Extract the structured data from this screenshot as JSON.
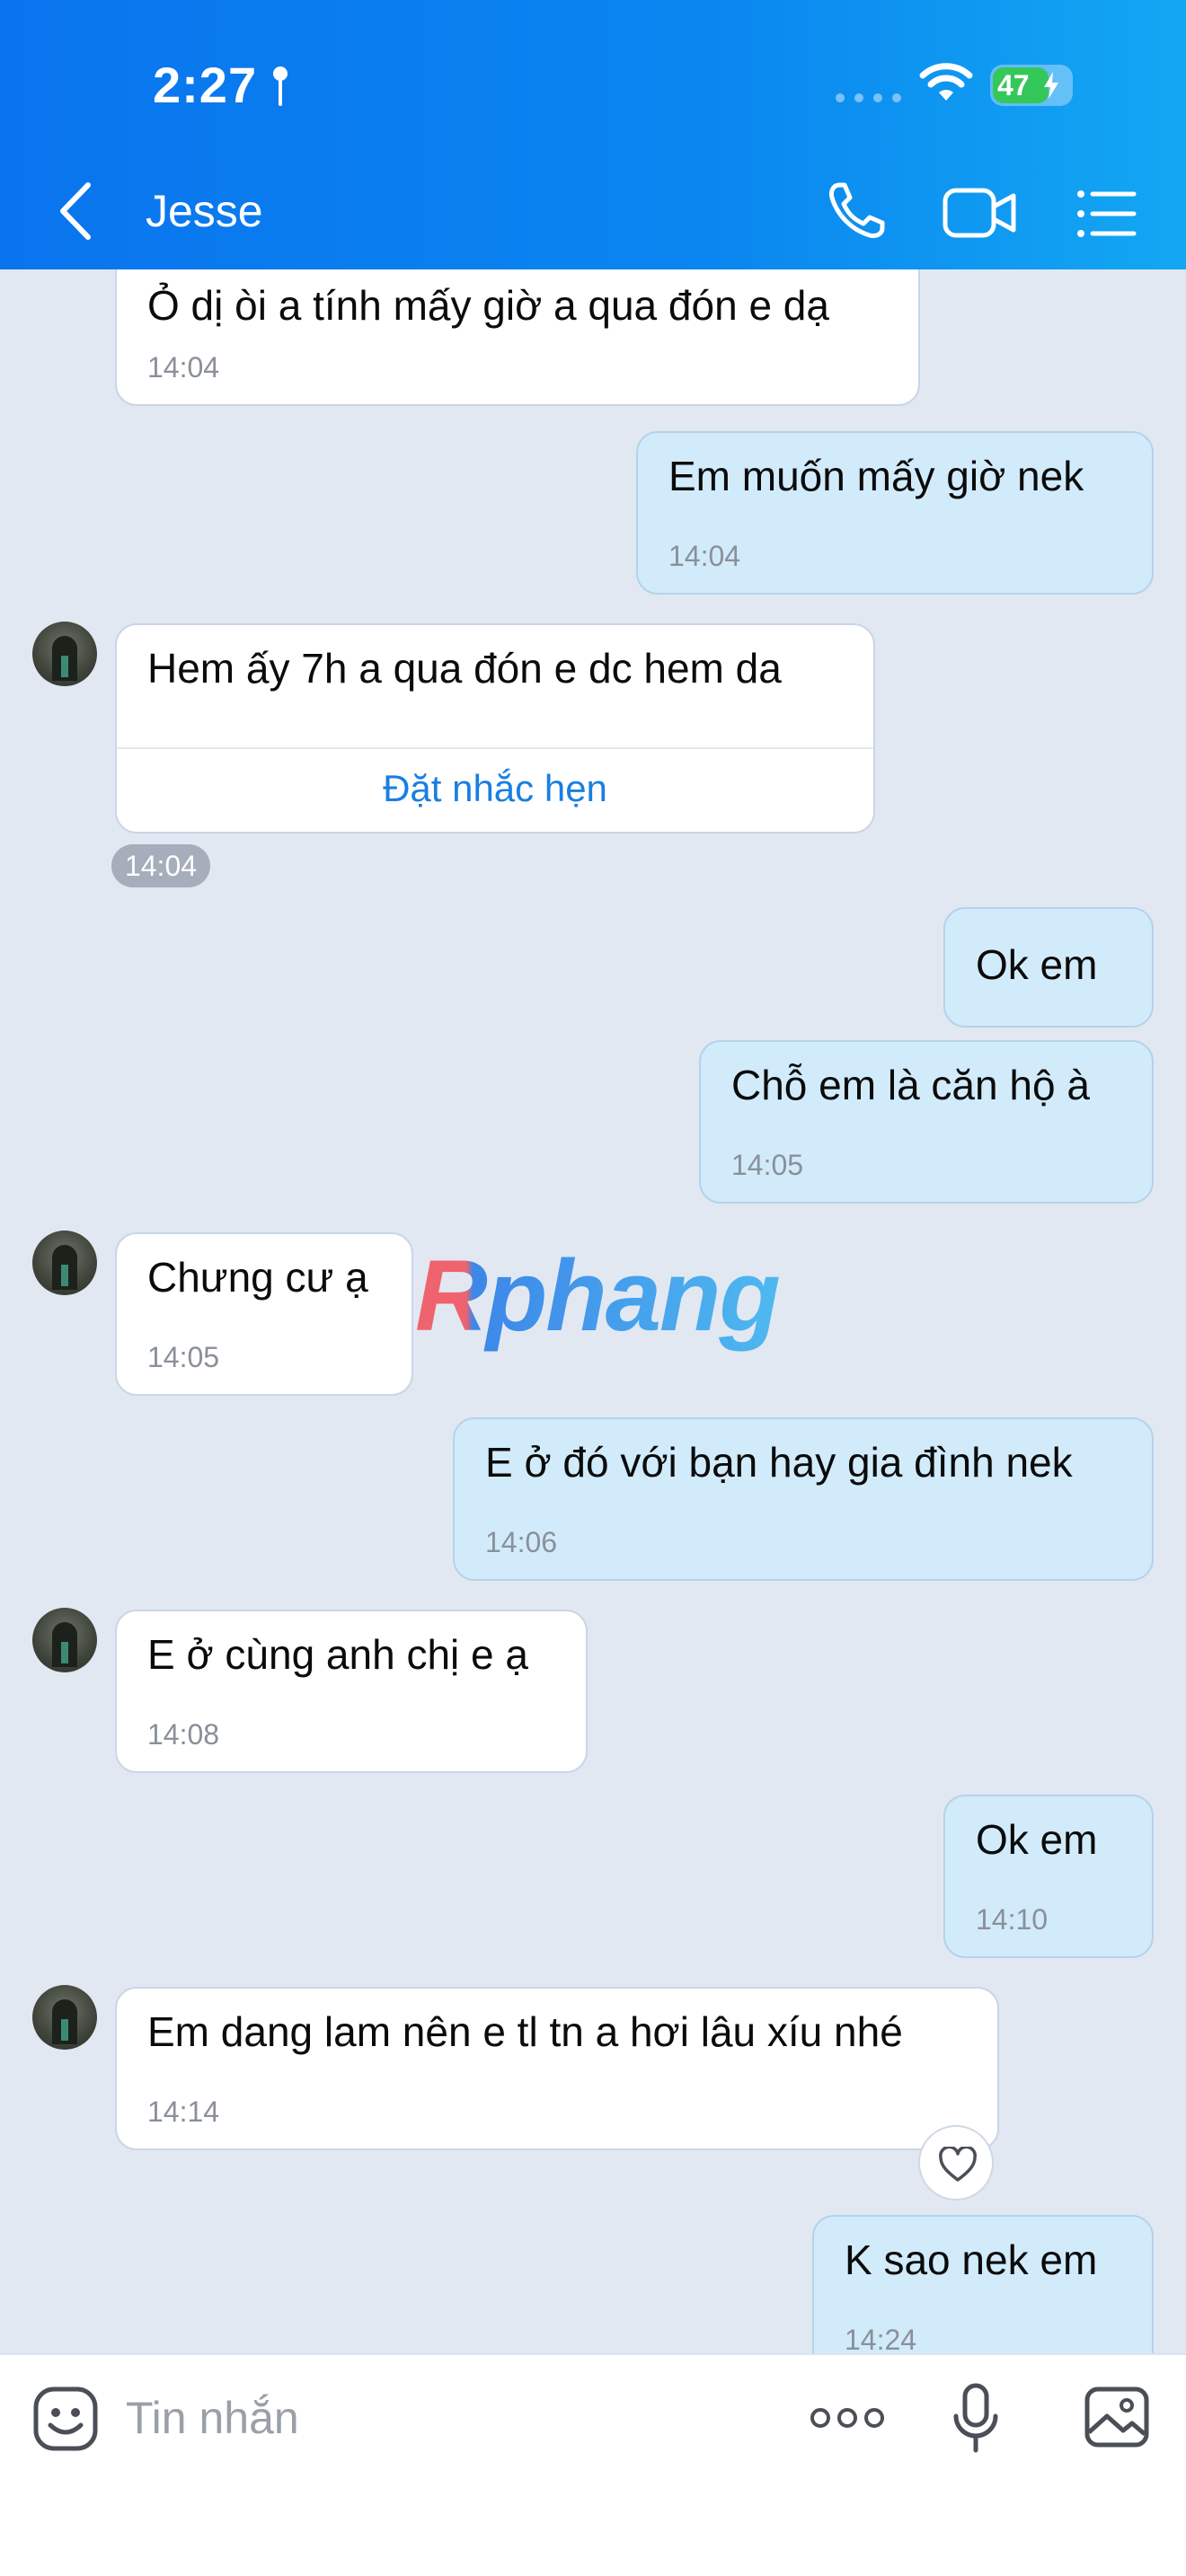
{
  "status_bar": {
    "time": "2:27",
    "battery": "47"
  },
  "header": {
    "contact_name": "Jesse"
  },
  "messages": [
    {
      "text": "Ỏ dị òi a tính mấy giờ a qua đón e dạ",
      "time": "14:04"
    },
    {
      "text": "Em muốn mấy giờ nek",
      "time": "14:04"
    },
    {
      "text": "Hem ấy 7h a qua đón e dc hem da",
      "time": "14:04",
      "action": "Đặt nhắc hẹn"
    },
    {
      "text": "Ok em"
    },
    {
      "text": "Chỗ em là căn hộ à",
      "time": "14:05"
    },
    {
      "text": "Chưng cư ạ",
      "time": "14:05"
    },
    {
      "text": "E ở đó với bạn hay gia đình nek",
      "time": "14:06"
    },
    {
      "text": "E ở cùng anh chị e ạ",
      "time": "14:08"
    },
    {
      "text": "Ok em",
      "time": "14:10"
    },
    {
      "text": "Em dang lam nên e tl tn a hơi lâu xíu nhé",
      "time": "14:14"
    },
    {
      "text": "K sao nek em",
      "time": "14:24"
    }
  ],
  "watermark": "Rphang",
  "input": {
    "placeholder": "Tin nhắn"
  },
  "icons": {
    "back": "chevron-left-icon",
    "call": "phone-icon",
    "video": "video-camera-icon",
    "menu": "list-menu-icon",
    "emoji": "emoji-icon",
    "more": "more-dots-icon",
    "mic": "microphone-icon",
    "image": "image-icon",
    "reaction": "heart-icon"
  },
  "colors": {
    "header_blue": "#0a86f0",
    "outgoing_bubble": "#d2ebfb",
    "incoming_bubble": "#ffffff",
    "chat_background": "#e2e8f1",
    "link_blue": "#1a7fe0",
    "battery_green": "#34c759"
  }
}
